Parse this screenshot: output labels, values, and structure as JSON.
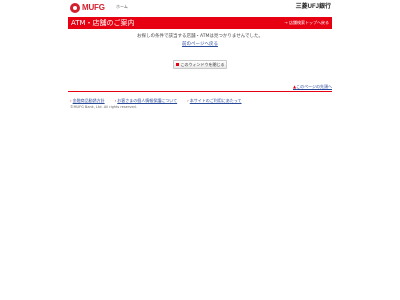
{
  "header": {
    "logo_text": "MUFG",
    "home_label": "ホーム",
    "bank_name": "三菱UFJ銀行"
  },
  "title_bar": {
    "title": "ATM・店舗のご案内",
    "top_link": "店舗検索トップへ戻る"
  },
  "main": {
    "message": "お探しの条件で該当する店舗・ATMは見つかりませんでした。",
    "back_link": "前のページへ戻る",
    "close_button": "このウィンドウを閉じる"
  },
  "page_top": "このページの先頭へ",
  "footer": {
    "links": [
      "金融商品勧誘方針",
      "お客さまの個人情報保護について",
      "本サイトのご利用にあたって"
    ],
    "copyright": "©MUFG Bank, Ltd. All rights reserved."
  },
  "colors": {
    "brand_red": "#e60012",
    "link_blue": "#2a4a9a"
  },
  "icons": {
    "logo": "mufg-logo-icon",
    "link_arrow": "arrow-right-icon"
  }
}
